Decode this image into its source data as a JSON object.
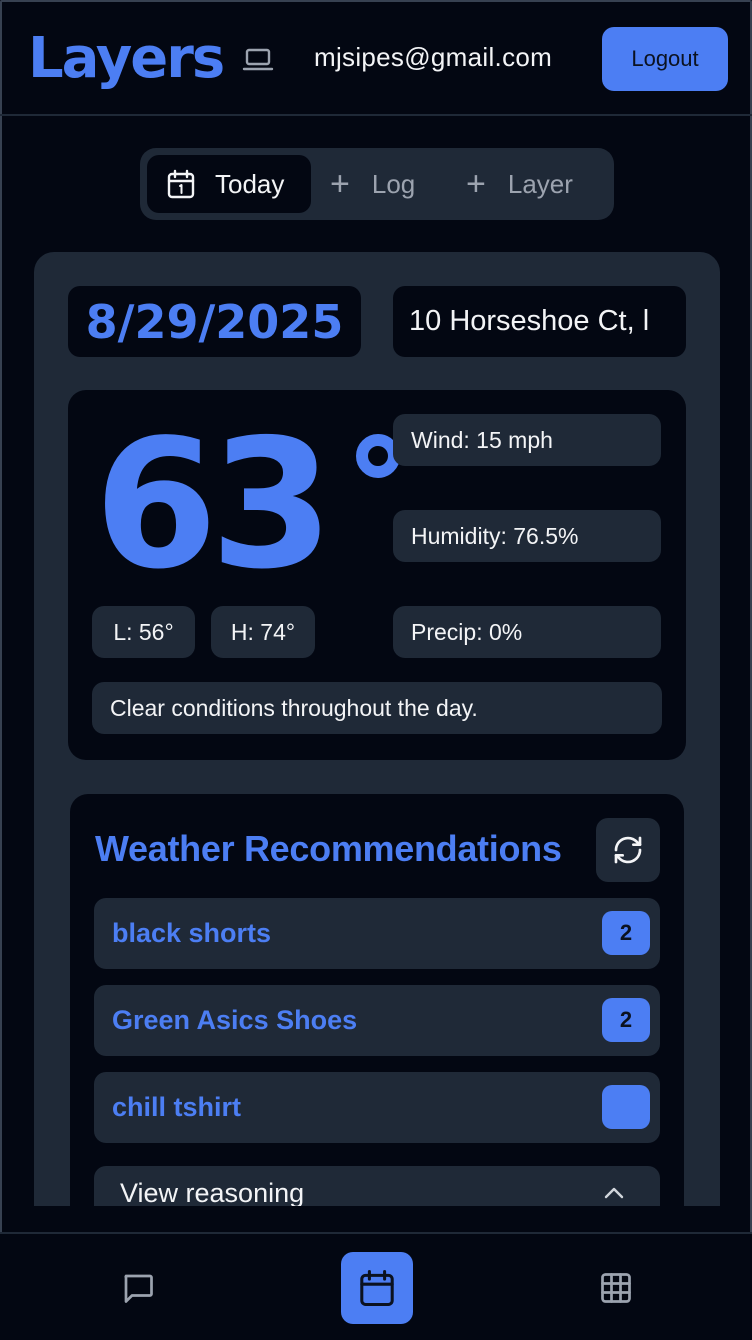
{
  "header": {
    "logo": "Layers",
    "device_icon": "laptop-icon",
    "email": "mjsipes@gmail.com",
    "logout_label": "Logout"
  },
  "tabs": [
    {
      "label": "Today",
      "icon": "calendar-icon",
      "active": true
    },
    {
      "label": "Log",
      "icon": "plus-icon",
      "active": false
    },
    {
      "label": "Layer",
      "icon": "plus-icon",
      "active": false
    }
  ],
  "day": {
    "date": "8/29/2025",
    "location_value": "10 Horseshoe Ct, l"
  },
  "weather": {
    "temp": "63",
    "low": "L: 56°",
    "high": "H: 74°",
    "wind": "Wind: 15 mph",
    "humidity": "Humidity: 76.5%",
    "precip": "Precip: 0%",
    "summary": "Clear conditions throughout the day."
  },
  "recommendations": {
    "title": "Weather Recommendations",
    "items": [
      {
        "name": "black shorts",
        "count": "2"
      },
      {
        "name": "Green Asics Shoes",
        "count": "2"
      },
      {
        "name": "chill tshirt",
        "count": ""
      }
    ],
    "reasoning_label": "View reasoning"
  },
  "bottom_nav": [
    {
      "icon": "chat-icon",
      "active": false
    },
    {
      "icon": "calendar-icon",
      "active": true
    },
    {
      "icon": "grid-icon",
      "active": false
    }
  ],
  "colors": {
    "accent": "#4c7ef3",
    "background": "#030712",
    "surface": "#1f2937",
    "muted_text": "#9ca3af"
  }
}
